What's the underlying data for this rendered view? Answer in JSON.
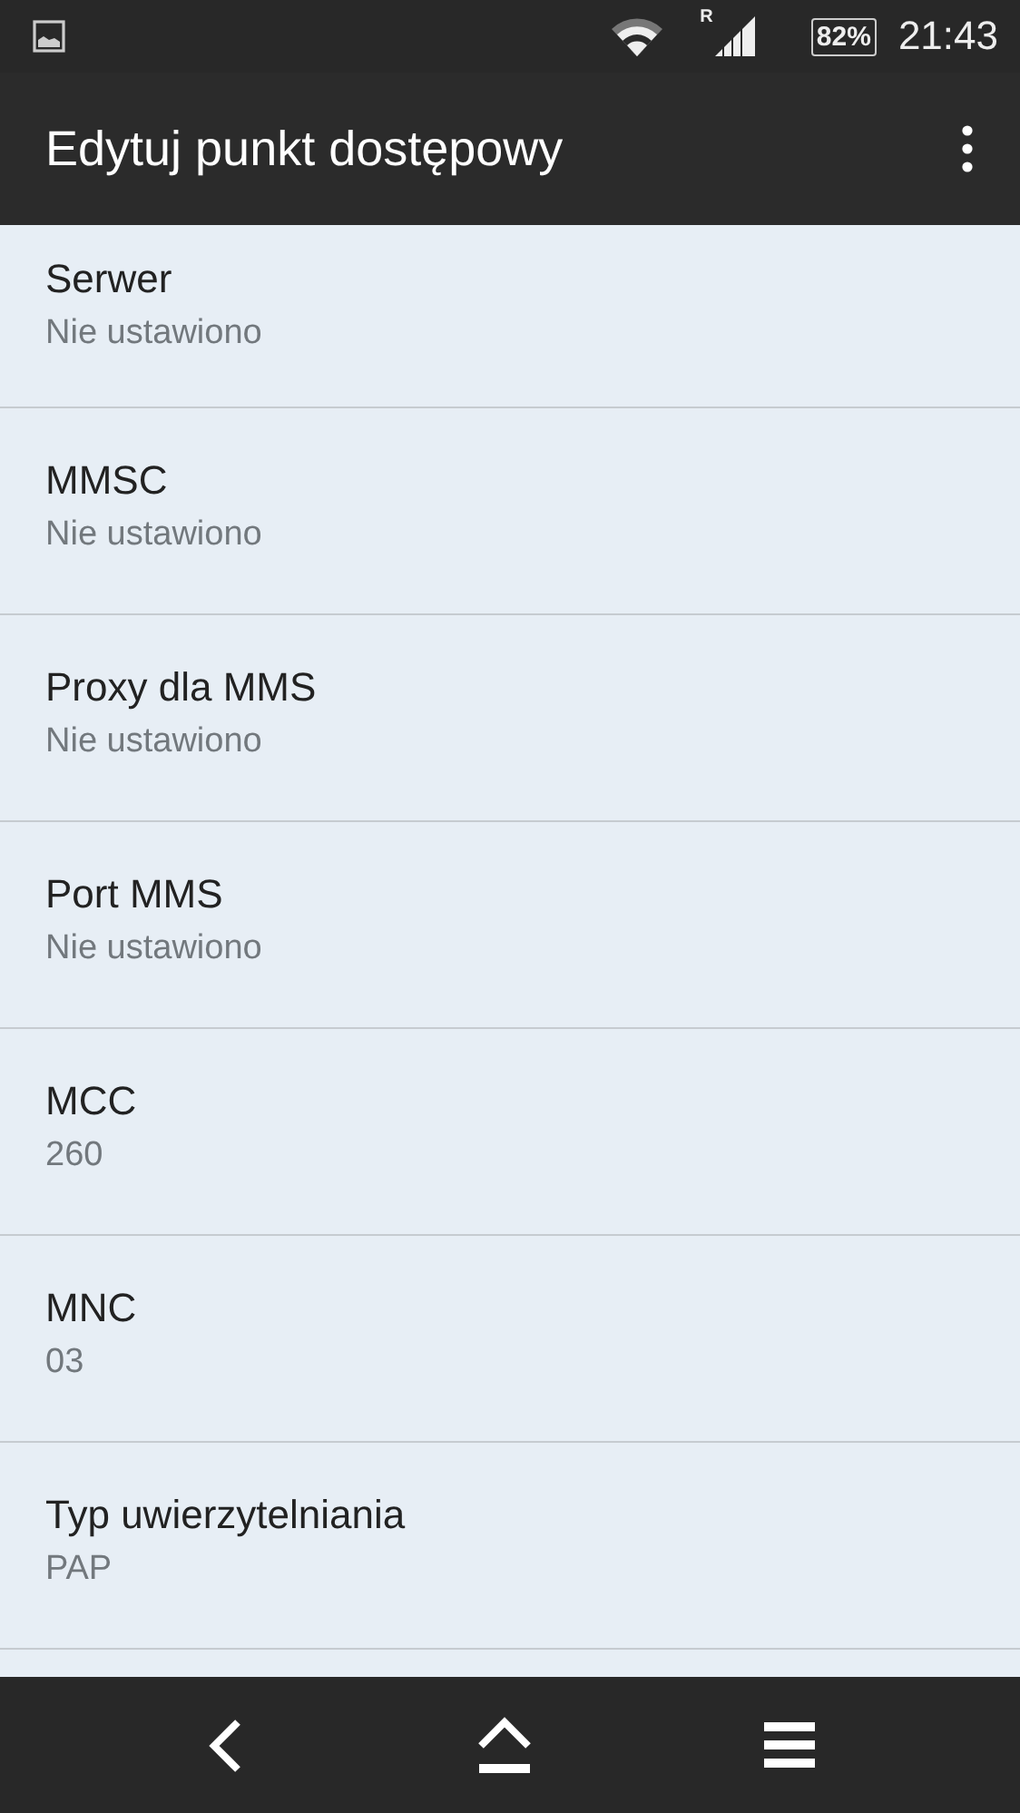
{
  "status_bar": {
    "roaming": "R",
    "battery": "82%",
    "time": "21:43"
  },
  "app_bar": {
    "title": "Edytuj punkt dostępowy"
  },
  "settings": [
    {
      "title": "Serwer",
      "value": "Nie ustawiono"
    },
    {
      "title": "MMSC",
      "value": "Nie ustawiono"
    },
    {
      "title": "Proxy dla MMS",
      "value": "Nie ustawiono"
    },
    {
      "title": "Port MMS",
      "value": "Nie ustawiono"
    },
    {
      "title": "MCC",
      "value": "260"
    },
    {
      "title": "MNC",
      "value": "03"
    },
    {
      "title": "Typ uwierzytelniania",
      "value": "PAP"
    }
  ]
}
